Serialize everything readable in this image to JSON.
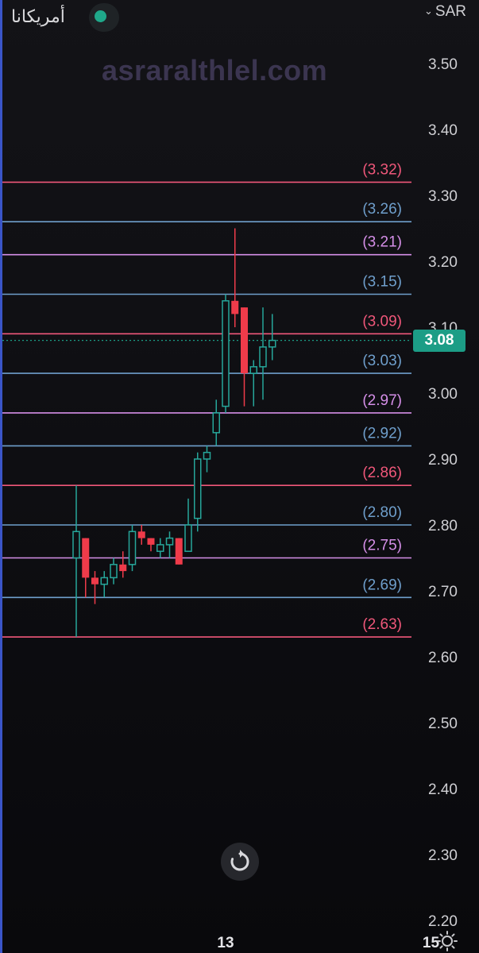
{
  "header": {
    "title": "أمريكانا",
    "currency": "SAR",
    "watermark": "asraralthlel.com"
  },
  "colors": {
    "up": "#26a69a",
    "down": "#ef3b4a",
    "level_red": "#f0577a",
    "level_blue": "#6f9fcc",
    "level_violet": "#d58fe8",
    "last_price_bg": "#1c9d86"
  },
  "icons": {
    "status": "status-dot",
    "dropdown": "chevron-down-icon",
    "reset": "reset-icon",
    "settings": "gear-icon"
  },
  "chart_data": {
    "type": "candlestick",
    "y_axis": {
      "ticks": [
        "3.50",
        "3.40",
        "3.30",
        "3.20",
        "3.10",
        "3.00",
        "2.90",
        "2.80",
        "2.70",
        "2.60",
        "2.50",
        "2.40",
        "2.30",
        "2.20"
      ],
      "min": 2.2,
      "max": 3.5
    },
    "x_axis": {
      "ticks": [
        {
          "label": "13",
          "index": 16
        },
        {
          "label": "15",
          "index": 38
        }
      ]
    },
    "last_price": "3.08",
    "levels": [
      {
        "label": "(3.32)",
        "value": 3.32,
        "color": "red"
      },
      {
        "label": "(3.26)",
        "value": 3.26,
        "color": "blue"
      },
      {
        "label": "(3.21)",
        "value": 3.21,
        "color": "violet"
      },
      {
        "label": "(3.15)",
        "value": 3.15,
        "color": "blue"
      },
      {
        "label": "(3.09)",
        "value": 3.09,
        "color": "red"
      },
      {
        "label": "(3.03)",
        "value": 3.03,
        "color": "blue"
      },
      {
        "label": "(2.97)",
        "value": 2.97,
        "color": "violet"
      },
      {
        "label": "(2.92)",
        "value": 2.92,
        "color": "blue"
      },
      {
        "label": "(2.86)",
        "value": 2.86,
        "color": "red"
      },
      {
        "label": "(2.80)",
        "value": 2.8,
        "color": "blue"
      },
      {
        "label": "(2.75)",
        "value": 2.75,
        "color": "violet"
      },
      {
        "label": "(2.69)",
        "value": 2.69,
        "color": "blue"
      },
      {
        "label": "(2.63)",
        "value": 2.63,
        "color": "red"
      }
    ],
    "candles": [
      {
        "o": 2.75,
        "h": 2.86,
        "l": 2.63,
        "c": 2.79
      },
      {
        "o": 2.78,
        "h": 2.78,
        "l": 2.69,
        "c": 2.72
      },
      {
        "o": 2.72,
        "h": 2.73,
        "l": 2.68,
        "c": 2.71
      },
      {
        "o": 2.71,
        "h": 2.73,
        "l": 2.69,
        "c": 2.72
      },
      {
        "o": 2.72,
        "h": 2.75,
        "l": 2.71,
        "c": 2.74
      },
      {
        "o": 2.74,
        "h": 2.76,
        "l": 2.72,
        "c": 2.73
      },
      {
        "o": 2.74,
        "h": 2.8,
        "l": 2.73,
        "c": 2.79
      },
      {
        "o": 2.79,
        "h": 2.8,
        "l": 2.77,
        "c": 2.78
      },
      {
        "o": 2.78,
        "h": 2.78,
        "l": 2.76,
        "c": 2.77
      },
      {
        "o": 2.76,
        "h": 2.78,
        "l": 2.75,
        "c": 2.77
      },
      {
        "o": 2.77,
        "h": 2.79,
        "l": 2.75,
        "c": 2.78
      },
      {
        "o": 2.78,
        "h": 2.78,
        "l": 2.74,
        "c": 2.74
      },
      {
        "o": 2.76,
        "h": 2.84,
        "l": 2.76,
        "c": 2.8
      },
      {
        "o": 2.81,
        "h": 2.91,
        "l": 2.79,
        "c": 2.9
      },
      {
        "o": 2.9,
        "h": 2.92,
        "l": 2.88,
        "c": 2.91
      },
      {
        "o": 2.94,
        "h": 2.99,
        "l": 2.92,
        "c": 2.97
      },
      {
        "o": 2.98,
        "h": 3.15,
        "l": 2.97,
        "c": 3.14
      },
      {
        "o": 3.14,
        "h": 3.25,
        "l": 3.1,
        "c": 3.12
      },
      {
        "o": 3.13,
        "h": 3.13,
        "l": 2.98,
        "c": 3.03
      },
      {
        "o": 3.03,
        "h": 3.05,
        "l": 2.98,
        "c": 3.04
      },
      {
        "o": 3.04,
        "h": 3.13,
        "l": 2.99,
        "c": 3.07
      },
      {
        "o": 3.07,
        "h": 3.12,
        "l": 3.05,
        "c": 3.08
      }
    ]
  }
}
